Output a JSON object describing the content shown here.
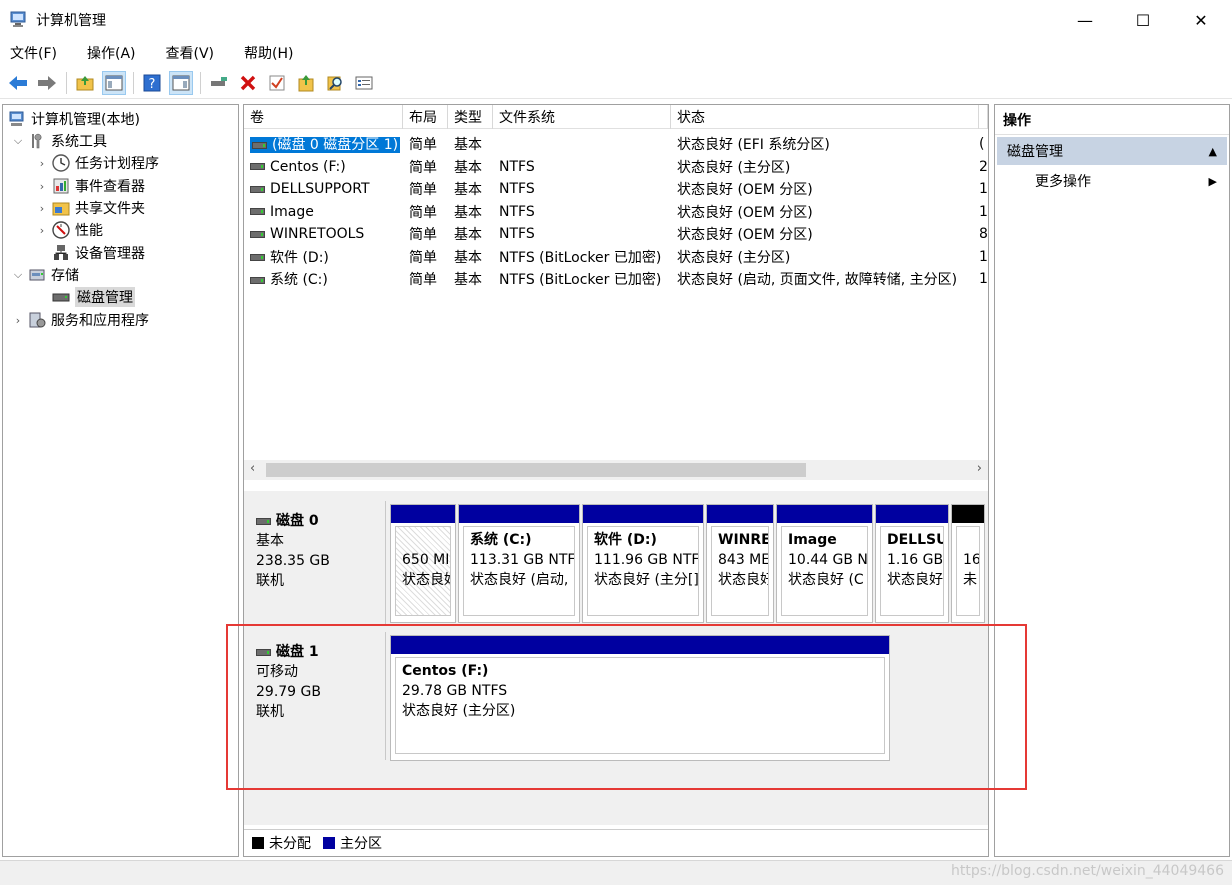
{
  "window": {
    "title": "计算机管理",
    "minimize": "—",
    "maximize": "☐",
    "close": "✕"
  },
  "menu": [
    "文件(F)",
    "操作(A)",
    "查看(V)",
    "帮助(H)"
  ],
  "toolbar_icons": [
    "back-arrow-icon",
    "forward-arrow-icon",
    "up-folder-icon",
    "show-hide-tree-icon",
    "help-icon",
    "properties-view-icon",
    "connect-icon",
    "delete-icon",
    "check-icon",
    "export-icon",
    "search-icon",
    "settings-icon"
  ],
  "tree": {
    "root": "计算机管理(本地)",
    "system_tools": "系统工具",
    "task_scheduler": "任务计划程序",
    "event_viewer": "事件查看器",
    "shared_folders": "共享文件夹",
    "performance": "性能",
    "device_manager": "设备管理器",
    "storage": "存储",
    "disk_management": "磁盘管理",
    "services": "服务和应用程序"
  },
  "volumes": {
    "columns": [
      "卷",
      "布局",
      "类型",
      "文件系统",
      "状态"
    ],
    "rows": [
      {
        "name": "(磁盘 0 磁盘分区 1)",
        "layout": "简单",
        "type": "基本",
        "fs": "",
        "status": "状态良好 (EFI 系统分区)",
        "extra": "("
      },
      {
        "name": "Centos (F:)",
        "layout": "简单",
        "type": "基本",
        "fs": "NTFS",
        "status": "状态良好 (主分区)",
        "extra": "2"
      },
      {
        "name": "DELLSUPPORT",
        "layout": "简单",
        "type": "基本",
        "fs": "NTFS",
        "status": "状态良好 (OEM 分区)",
        "extra": "1"
      },
      {
        "name": "Image",
        "layout": "简单",
        "type": "基本",
        "fs": "NTFS",
        "status": "状态良好 (OEM 分区)",
        "extra": "1"
      },
      {
        "name": "WINRETOOLS",
        "layout": "简单",
        "type": "基本",
        "fs": "NTFS",
        "status": "状态良好 (OEM 分区)",
        "extra": "8"
      },
      {
        "name": "软件 (D:)",
        "layout": "简单",
        "type": "基本",
        "fs": "NTFS (BitLocker 已加密)",
        "status": "状态良好 (主分区)",
        "extra": "1"
      },
      {
        "name": "系统 (C:)",
        "layout": "简单",
        "type": "基本",
        "fs": "NTFS (BitLocker 已加密)",
        "status": "状态良好 (启动, 页面文件, 故障转储, 主分区)",
        "extra": "1"
      }
    ]
  },
  "disk0": {
    "title": "磁盘 0",
    "kind": "基本",
    "size": "238.35 GB",
    "state": "联机",
    "partitions": [
      {
        "name": "",
        "size": "650 MI",
        "status": "状态良好"
      },
      {
        "name": "系统 (C:)",
        "size": "113.31 GB NTF",
        "status": "状态良好 (启动,"
      },
      {
        "name": "软件 (D:)",
        "size": "111.96 GB NTF",
        "status": "状态良好 (主分[]"
      },
      {
        "name": "WINRE",
        "size": "843 ME",
        "status": "状态良好"
      },
      {
        "name": "Image",
        "size": "10.44 GB N",
        "status": "状态良好 (C"
      },
      {
        "name": "DELLSU",
        "size": "1.16 GB",
        "status": "状态良好"
      },
      {
        "name": "",
        "size": "16",
        "status": "未"
      }
    ]
  },
  "disk1": {
    "title": "磁盘 1",
    "kind": "可移动",
    "size": "29.79 GB",
    "state": "联机",
    "partition": {
      "name": "Centos  (F:)",
      "size": "29.78 GB NTFS",
      "status": "状态良好 (主分区)"
    }
  },
  "legend": {
    "unallocated": "未分配",
    "primary": "主分区"
  },
  "actions": {
    "title": "操作",
    "section": "磁盘管理",
    "more": "更多操作"
  },
  "colors": {
    "primary_partition": "#0000a0",
    "unallocated": "#000000",
    "selection": "#0078d7",
    "highlight_box": "#e53935"
  },
  "watermark": "https://blog.csdn.net/weixin_44049466"
}
